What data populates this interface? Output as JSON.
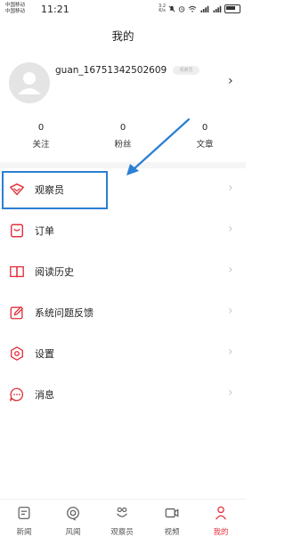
{
  "status_bar": {
    "carrier_line1": "中国移动",
    "carrier_line2": "中国移动",
    "time": "11:21",
    "speed_value": "3.2",
    "speed_unit": "K/s",
    "icons": [
      "mute-icon",
      "alarm-icon",
      "wifi-icon",
      "signal-4g-icon",
      "signal-4g-icon",
      "battery-icon"
    ]
  },
  "page": {
    "title": "我的"
  },
  "profile": {
    "username": "guan_16751342502609",
    "badge": "观察员"
  },
  "stats": [
    {
      "value": "0",
      "label": "关注"
    },
    {
      "value": "0",
      "label": "粉丝"
    },
    {
      "value": "0",
      "label": "文章"
    }
  ],
  "menu": [
    {
      "label": "观察员",
      "icon": "observer-icon"
    },
    {
      "label": "订单",
      "icon": "order-icon"
    },
    {
      "label": "阅读历史",
      "icon": "book-icon"
    },
    {
      "label": "系统问题反馈",
      "icon": "feedback-icon"
    },
    {
      "label": "设置",
      "icon": "settings-icon"
    },
    {
      "label": "消息",
      "icon": "message-icon"
    }
  ],
  "tabs": [
    {
      "label": "新闻",
      "icon": "news-icon"
    },
    {
      "label": "风闻",
      "icon": "fengwen-icon"
    },
    {
      "label": "观察员",
      "icon": "observer-tab-icon"
    },
    {
      "label": "视频",
      "icon": "video-icon"
    },
    {
      "label": "我的",
      "icon": "profile-icon",
      "active": true
    }
  ],
  "colors": {
    "accent": "#e2323c",
    "annotation": "#2b7fd4"
  }
}
